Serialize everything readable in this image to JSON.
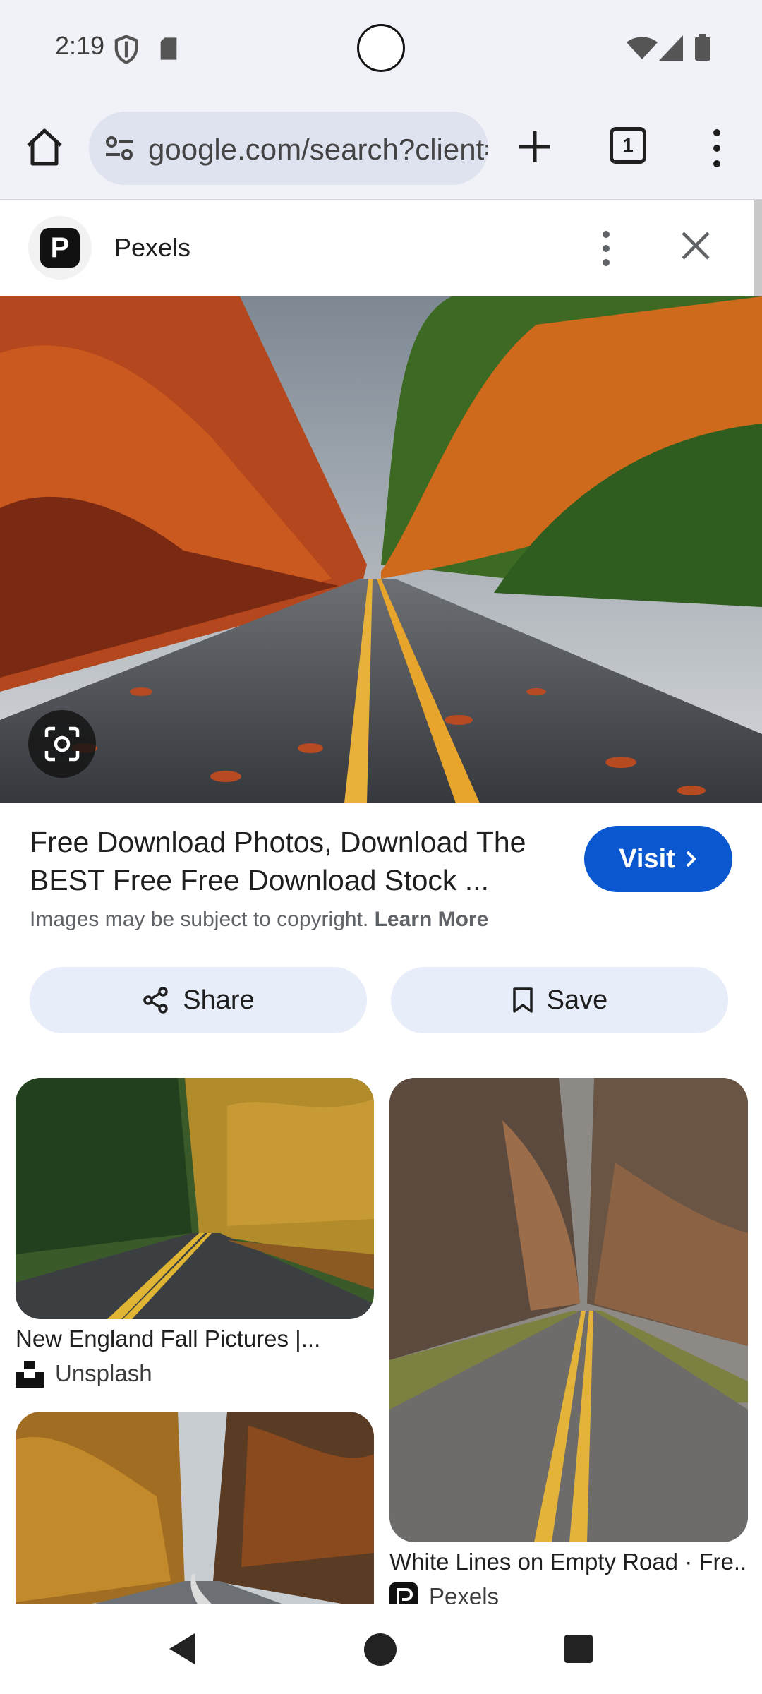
{
  "status_bar": {
    "time": "2:19"
  },
  "toolbar": {
    "url": "google.com/search?client=ms-android",
    "tab_count": "1"
  },
  "panel": {
    "source_name": "Pexels",
    "source_logo_letter": "P",
    "title": "Free Download Photos, Download The BEST Free Free Download Stock ...",
    "visit_label": "Visit",
    "copyright_text": "Images may be subject to copyright.",
    "learn_more_label": "Learn More",
    "share_label": "Share",
    "save_label": "Save"
  },
  "related": [
    {
      "title": "New England Fall Pictures |...",
      "source": "Unsplash"
    },
    {
      "title": "White Lines on Empty Road · Fre...",
      "source": "Pexels"
    }
  ],
  "icons": {
    "home": "home-icon",
    "plus": "add-tab-icon",
    "tabs": "tab-switcher-icon",
    "menu": "more-vert-icon",
    "lens": "google-lens-icon",
    "share": "share-icon",
    "save": "bookmark-icon",
    "close": "close-icon"
  },
  "colors": {
    "accent": "#0b57d0",
    "chrome_bg": "#f1f2f8",
    "pill_bg": "#e7edf9"
  }
}
